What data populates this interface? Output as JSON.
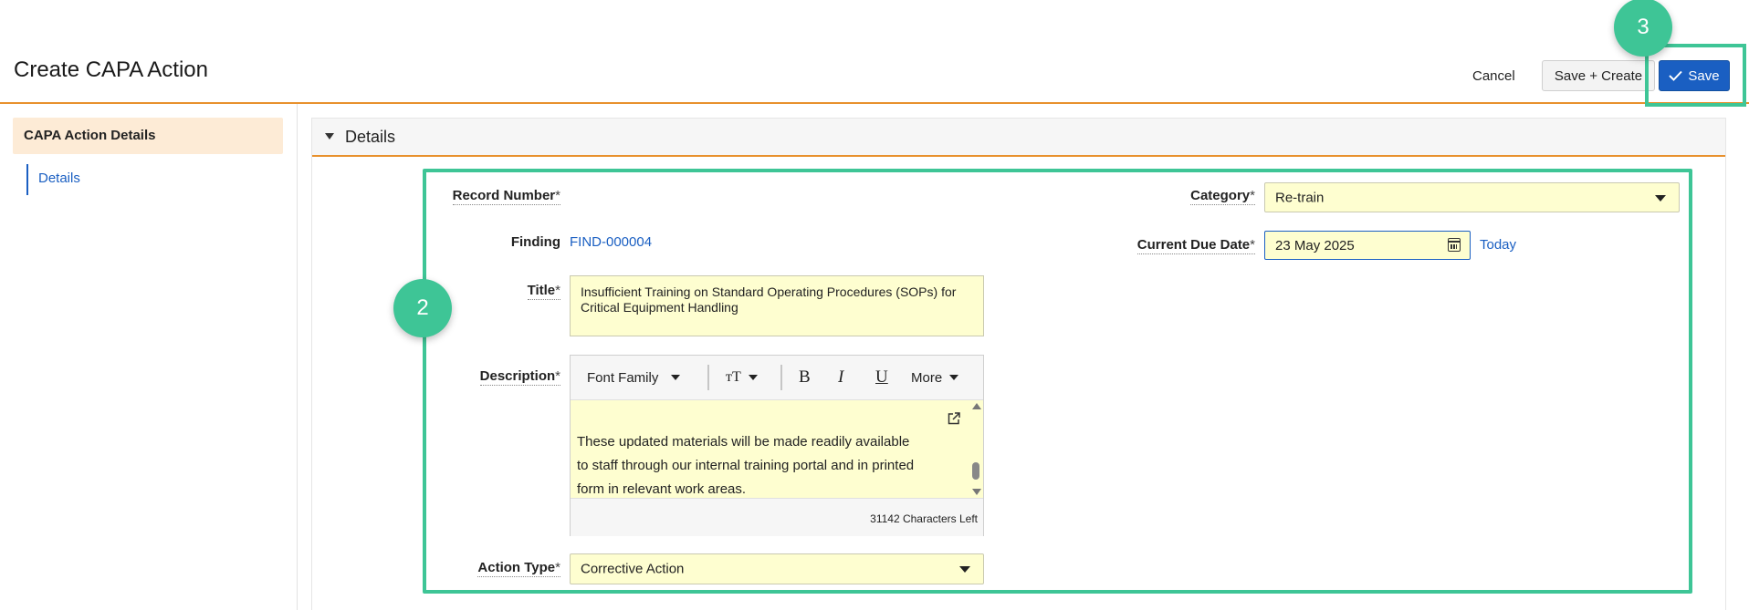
{
  "header": {
    "title": "Create CAPA Action",
    "cancel_label": "Cancel",
    "save_create_label": "Save + Create",
    "save_label": "Save",
    "accent_color": "#e8912d",
    "primary_color": "#1a5fc2"
  },
  "sidebar": {
    "section_label": "CAPA Action Details",
    "items": [
      {
        "label": "Details"
      }
    ]
  },
  "details": {
    "section_title": "Details",
    "record_number": {
      "label": "Record Number",
      "required": "*"
    },
    "finding": {
      "label": "Finding",
      "value": "FIND-000004"
    },
    "title": {
      "label": "Title",
      "required": "*",
      "value": "Insufficient Training on Standard Operating Procedures (SOPs) for Critical Equipment Handling"
    },
    "description": {
      "label": "Description",
      "required": "*",
      "toolbar": {
        "font_family": "Font Family",
        "font_size_icon": "ᴛT",
        "bold": "B",
        "italic": "I",
        "underline": "U",
        "more": "More"
      },
      "visible_text": "These updated materials will be made readily available to staff through our internal training portal and in printed form in relevant work areas.",
      "chars_left": "31142 Characters Left"
    },
    "action_type": {
      "label": "Action Type",
      "required": "*",
      "value": "Corrective Action"
    },
    "category": {
      "label": "Category",
      "required": "*",
      "value": "Re-train"
    },
    "current_due_date": {
      "label": "Current Due Date",
      "required": "*",
      "value": "23 May 2025",
      "today_label": "Today"
    }
  },
  "annotations": {
    "step_form": "2",
    "step_save": "3",
    "highlight_color": "#3ec596"
  }
}
